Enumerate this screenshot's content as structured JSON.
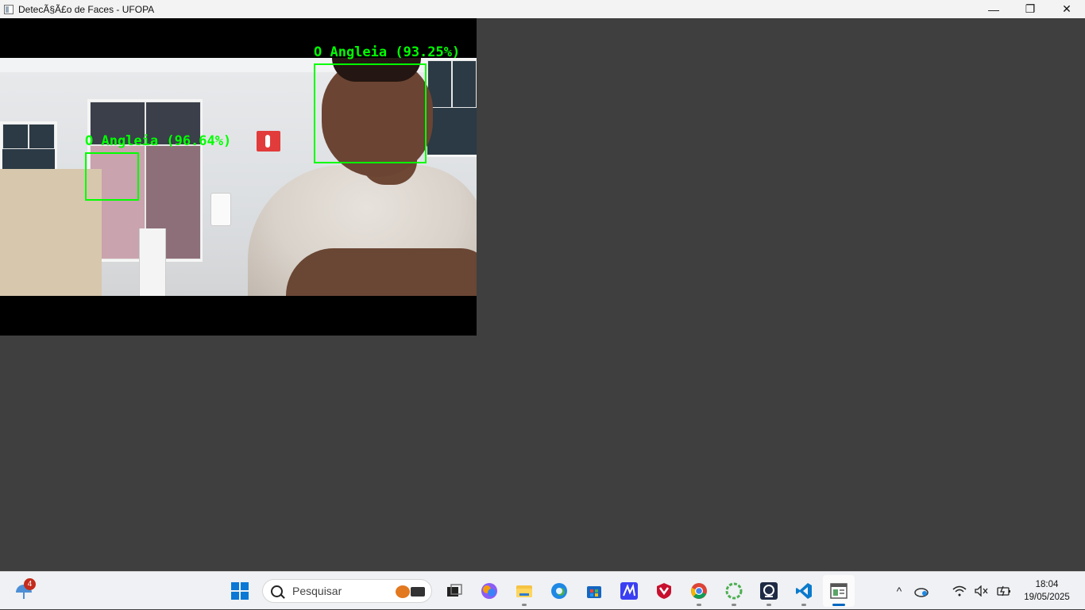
{
  "window": {
    "title": "DetecÃ§Ã£o de Faces - UFOPA",
    "controls": {
      "minimize": "—",
      "restore": "❐",
      "close": "✕"
    }
  },
  "detections": [
    {
      "label": "O Angleia (93.25%)"
    },
    {
      "label": "O Angleia (96.64%)"
    }
  ],
  "taskbar": {
    "widget_badge": "4",
    "search_placeholder": "Pesquisar",
    "apps": [
      "task-view",
      "copilot",
      "file-explorer",
      "edge",
      "store",
      "app-m",
      "mcafee",
      "chrome",
      "app-ring",
      "webcam-app",
      "vscode",
      "active-window"
    ],
    "tray": {
      "chevron": "^",
      "time": "18:04",
      "date": "19/05/2025"
    }
  },
  "colors": {
    "detection": "#00ff00",
    "accent": "#0067c0"
  }
}
